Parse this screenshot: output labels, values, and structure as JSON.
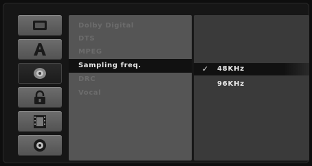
{
  "sidebar": {
    "icons": [
      {
        "name": "disc-setup-icon"
      },
      {
        "name": "language-icon"
      },
      {
        "name": "audio-icon",
        "selected": true
      },
      {
        "name": "lock-icon"
      },
      {
        "name": "film-icon"
      },
      {
        "name": "disc-icon"
      }
    ]
  },
  "menu": {
    "items": [
      {
        "label": "Dolby Digital"
      },
      {
        "label": "DTS"
      },
      {
        "label": "MPEG"
      },
      {
        "label": "Sampling freq.",
        "active": true
      },
      {
        "label": "DRC"
      },
      {
        "label": "Vocal"
      }
    ]
  },
  "submenu": {
    "options": [
      {
        "label": "48KHz",
        "checkmark": "✓",
        "selected": true
      },
      {
        "label": "96KHz",
        "checkmark": "",
        "selected": false
      }
    ]
  }
}
